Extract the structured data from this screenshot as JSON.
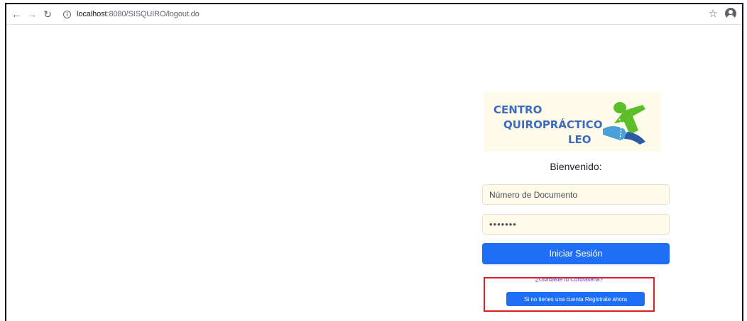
{
  "browser": {
    "back_icon": "back-arrow-icon",
    "forward_icon": "forward-arrow-icon",
    "reload_icon": "reload-icon",
    "url_host": "localhost",
    "url_path": ":8080/SISQUIRO/logout.do",
    "bookmark_icon": "star-icon",
    "profile_icon": "account-circle-icon"
  },
  "logo": {
    "line1": "CENTRO",
    "line2": "QUIROPRÁCTICO",
    "line3": "LEO",
    "text_color": "#3d6bbf",
    "figure_color": "#5cbf2a"
  },
  "login": {
    "welcome": "Bienvenido:",
    "document_value": "Número de Documento",
    "password_value": "•••••••",
    "submit_label": "Iniciar Sesión",
    "forgot_label": "¿Olvidaste tu Contraseña?",
    "register_label": "Si no tienes una cuenta Registrate ahora",
    "accent_color": "#1e6ff6",
    "highlight_color": "#e02020"
  }
}
